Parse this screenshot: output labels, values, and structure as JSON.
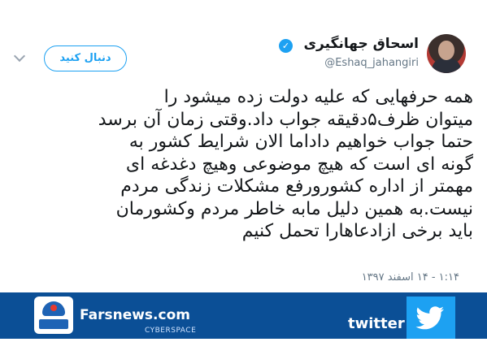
{
  "tweet": {
    "author_name": "اسحاق جهانگیری",
    "handle": "@Eshaq_jahangiri",
    "follow_label": "دنبال کنید",
    "lines": [
      "همه حرفهایی که علیه دولت زده میشود را",
      "میتوان ظرف۵دقیقه جواب داد.وقتی زمان آن برسد",
      "حتما جواب خواهیم داداما الان شرایط کشور به",
      "گونه ای است که هیچ موضوعی وهیچ دغدغه ای",
      "مهمتر از اداره کشورورفع مشکلات زندگی مردم",
      "نیست.به همین دلیل مابه خاطر مردم وکشورمان",
      "باید برخی ازادعاهارا تحمل کنیم"
    ],
    "timestamp": "۱:۱۴ - ۱۴ اسفند ۱۳۹۷"
  },
  "footer": {
    "site_name": "Farsnews.com",
    "section": "CYBERSPACE",
    "twitter_label": "twitter"
  },
  "icons": {
    "verified": "verified-badge-icon",
    "chevron": "chevron-down-icon",
    "twitter": "twitter-bird-icon",
    "farsnews": "farsnews-logo-icon"
  },
  "colors": {
    "accent": "#1da1f2",
    "footer_bg": "#0b4f96",
    "text": "#14171a",
    "muted": "#657786"
  }
}
